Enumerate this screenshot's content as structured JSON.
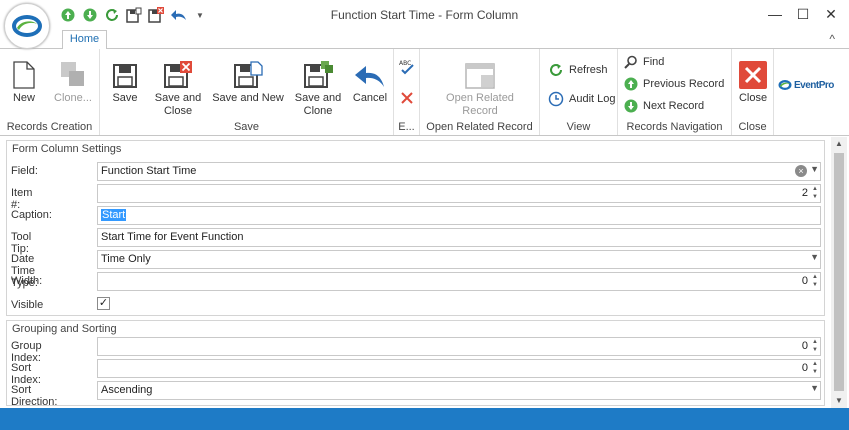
{
  "window": {
    "title": "Function Start Time - Form Column",
    "minimize_icon": "minimize-icon",
    "maximize_icon": "maximize-icon",
    "close_icon": "close-icon"
  },
  "qat": [
    "save-up-icon",
    "save-down-icon",
    "refresh-icon",
    "save-and-new-icon",
    "save-and-close-icon",
    "undo-icon",
    "customize-dropdown-icon"
  ],
  "tabs": {
    "home": "Home"
  },
  "ribbon": {
    "records_creation": {
      "label": "Records Creation",
      "new": "New",
      "clone": "Clone..."
    },
    "save": {
      "label": "Save",
      "save": "Save",
      "save_and_close_1": "Save and",
      "save_and_close_2": "Close",
      "save_and_new": "Save and New",
      "save_and_clone_1": "Save and",
      "save_and_clone_2": "Clone",
      "cancel": "Cancel"
    },
    "edit": {
      "label": "E..."
    },
    "open_related": {
      "label": "Open Related Record",
      "btn_1": "Open Related",
      "btn_2": "Record"
    },
    "view": {
      "label": "View",
      "refresh": "Refresh",
      "audit_log": "Audit Log"
    },
    "records_navigation": {
      "label": "Records Navigation",
      "find": "Find",
      "previous": "Previous Record",
      "next": "Next Record"
    },
    "close": {
      "label": "Close",
      "close": "Close"
    },
    "brand": "EventPro"
  },
  "form_column_settings": {
    "title": "Form Column Settings",
    "field": {
      "label": "Field:",
      "value": "Function Start Time"
    },
    "item_no": {
      "label": "Item #:",
      "value": "2"
    },
    "caption": {
      "label": "Caption:",
      "value": "Start"
    },
    "tool_tip": {
      "label": "Tool Tip:",
      "value": "Start Time for Event Function"
    },
    "date_time_type": {
      "label": "Date Time Type:",
      "value": "Time Only"
    },
    "width": {
      "label": "Width:",
      "value": "0"
    },
    "visible": {
      "label": "Visible",
      "checked": true,
      "mark": "✓"
    }
  },
  "grouping_sorting": {
    "title": "Grouping and Sorting",
    "group_index": {
      "label": "Group Index:",
      "value": "0"
    },
    "sort_index": {
      "label": "Sort Index:",
      "value": "0"
    },
    "sort_direction": {
      "label": "Sort Direction:",
      "value": "Ascending"
    }
  },
  "colors": {
    "accent": "#1e7bc6",
    "title_text": "#444444"
  }
}
